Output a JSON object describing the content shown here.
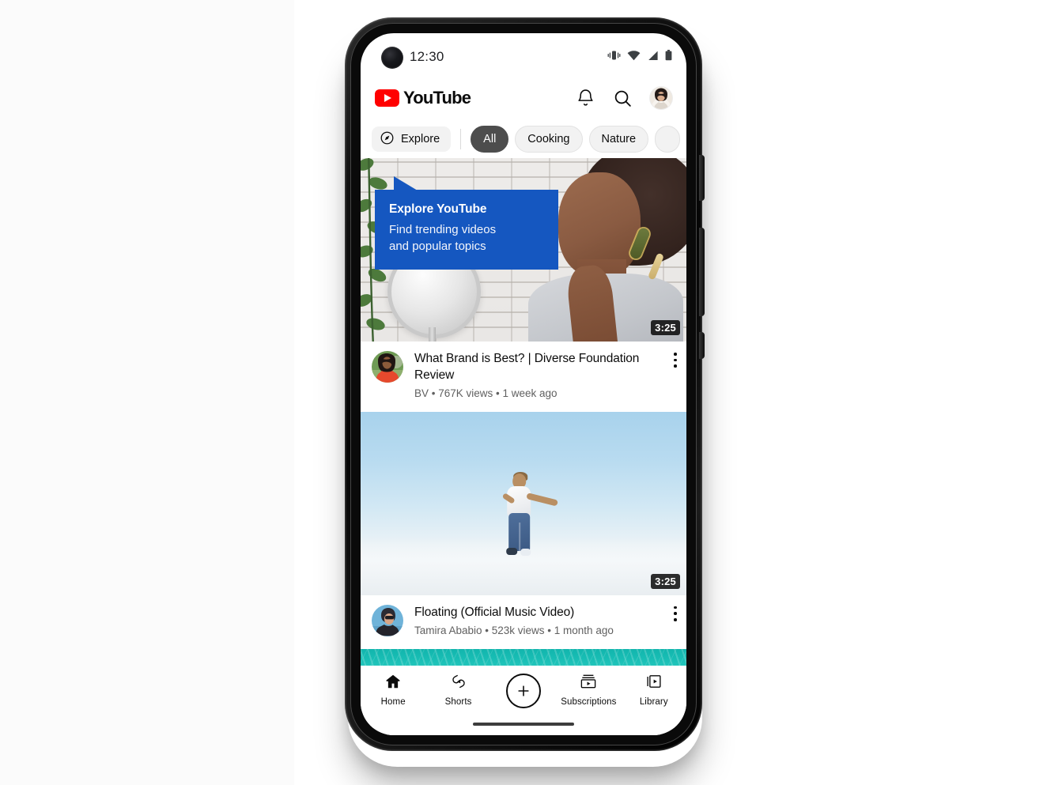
{
  "device": {
    "type": "smartphone-mockup",
    "frame_color": "#0a0a0a"
  },
  "status_bar": {
    "time": "12:30",
    "icons": [
      "vibrate-icon",
      "wifi-icon",
      "cellular-signal-icon",
      "battery-icon"
    ]
  },
  "app_header": {
    "brand_name": "YouTube",
    "brand_color": "#FF0000",
    "logo_icon": "youtube-play-logo-icon",
    "actions": [
      {
        "icon": "notifications-bell-icon",
        "label": "Notifications"
      },
      {
        "icon": "search-icon",
        "label": "Search"
      },
      {
        "icon": "account-avatar",
        "label": "Account"
      }
    ]
  },
  "chips": {
    "explore": {
      "label": "Explore",
      "icon": "compass-explore-icon"
    },
    "items": [
      {
        "label": "All",
        "selected": true
      },
      {
        "label": "Cooking",
        "selected": false
      },
      {
        "label": "Nature",
        "selected": false
      },
      {
        "label": "",
        "selected": false
      }
    ],
    "active_color": "#4d4d4d"
  },
  "tooltip": {
    "title": "Explore YouTube",
    "body_line1": "Find trending videos",
    "body_line2": "and popular topics",
    "background_color": "#1557c0",
    "text_color": "#ffffff",
    "points_at": "explore-chip"
  },
  "feed": {
    "videos": [
      {
        "title": "What Brand is Best? | Diverse Foundation Review",
        "channel": "BV",
        "views": "767K views",
        "age": "1 week ago",
        "meta_line": "BV •  767K views • 1 week ago",
        "duration": "3:25",
        "thumbnail_alt": "Woman using a jade face roller in front of a mirror",
        "menu_icon": "kebab-menu-icon"
      },
      {
        "title": "Floating (Official Music Video)",
        "channel": "Tamira Ababio",
        "views": "523k views",
        "age": "1 month ago",
        "meta_line": "Tamira Ababio • 523k views • 1 month ago",
        "duration": "3:25",
        "thumbnail_alt": "Person floating in a pale blue sky above clouds",
        "menu_icon": "kebab-menu-icon"
      },
      {
        "title": "",
        "channel": "",
        "views": "",
        "age": "",
        "meta_line": "",
        "duration": "",
        "thumbnail_alt": "Turquoise water surface, partially visible",
        "menu_icon": "kebab-menu-icon"
      }
    ]
  },
  "bottom_nav": {
    "items": [
      {
        "label": "Home",
        "icon": "home-icon",
        "active": true
      },
      {
        "label": "Shorts",
        "icon": "shorts-icon",
        "active": false
      },
      {
        "label": "",
        "icon": "create-plus-icon",
        "active": false
      },
      {
        "label": "Subscriptions",
        "icon": "subscriptions-icon",
        "active": false
      },
      {
        "label": "Library",
        "icon": "library-icon",
        "active": false
      }
    ]
  }
}
